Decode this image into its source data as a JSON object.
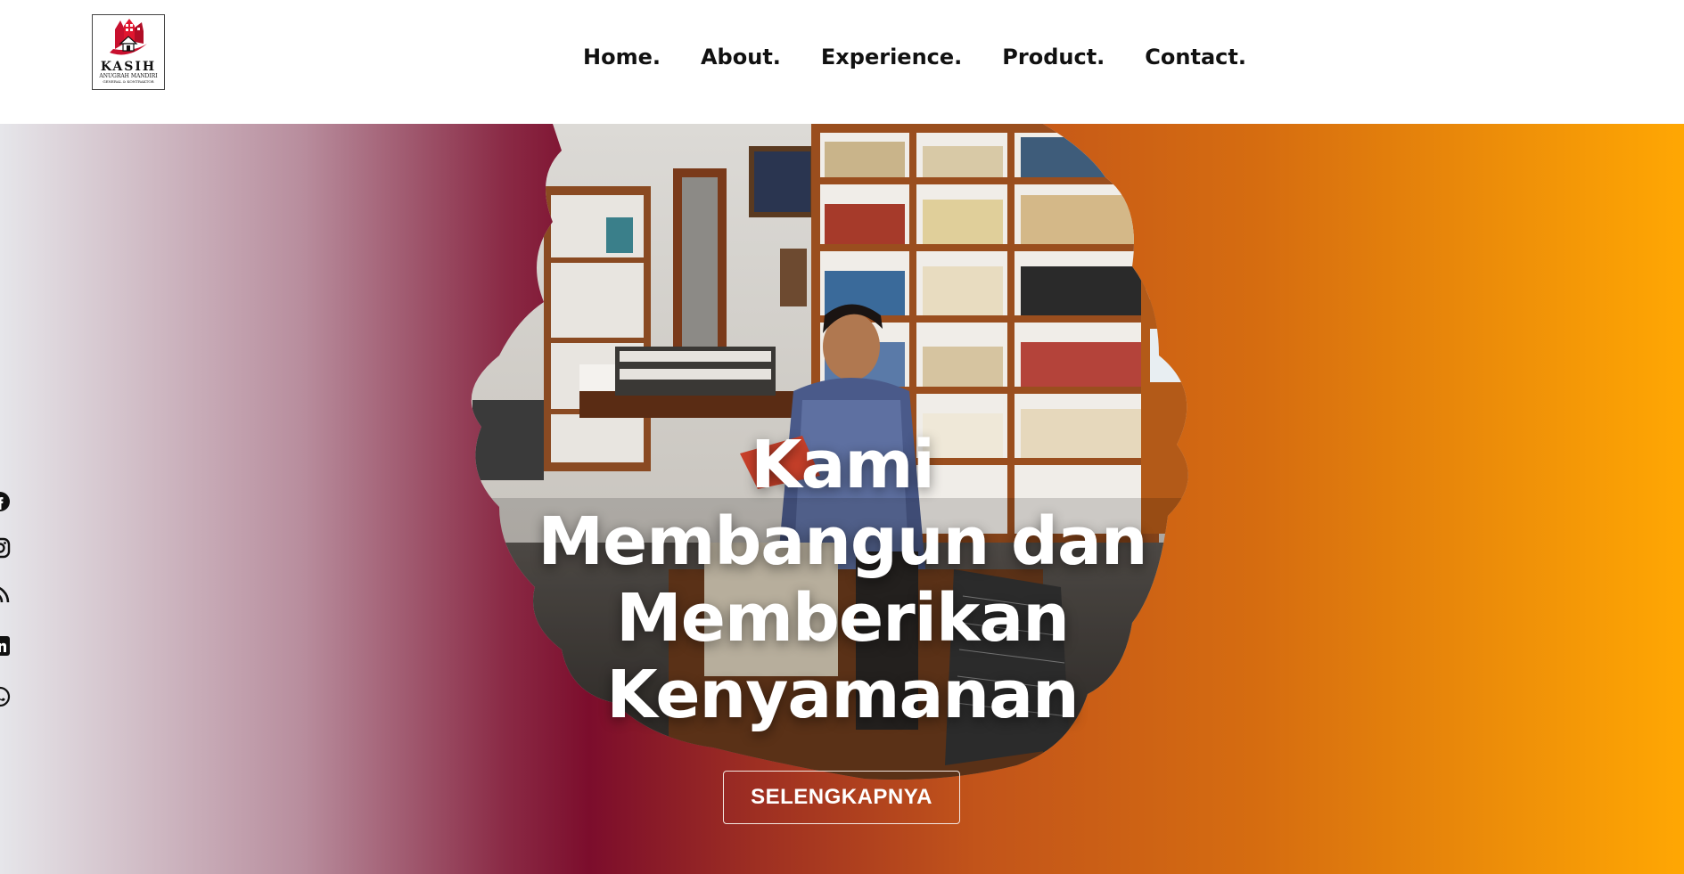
{
  "brand": {
    "logo_title": "KASIH",
    "logo_subtitle": "ANUGRAH MANDIRI",
    "logo_tagline": "GENERAL & KONTRAKTOR",
    "primary_red": "#c8102e"
  },
  "nav": {
    "items": [
      "Home.",
      "About.",
      "Experience.",
      "Product.",
      "Contact."
    ]
  },
  "hero": {
    "title_lines": [
      "Kami",
      "Membangun dan",
      "Memberikan",
      "Kenyamanan"
    ],
    "cta_label": "SELENGKAPNYA",
    "gradient_colors": [
      "#e6e6ea",
      "#7c0d2c",
      "#c2541a",
      "#ffa703"
    ]
  },
  "social": {
    "icons": [
      "facebook-icon",
      "instagram-icon",
      "rss-icon",
      "linkedin-icon",
      "whatsapp-icon"
    ]
  }
}
